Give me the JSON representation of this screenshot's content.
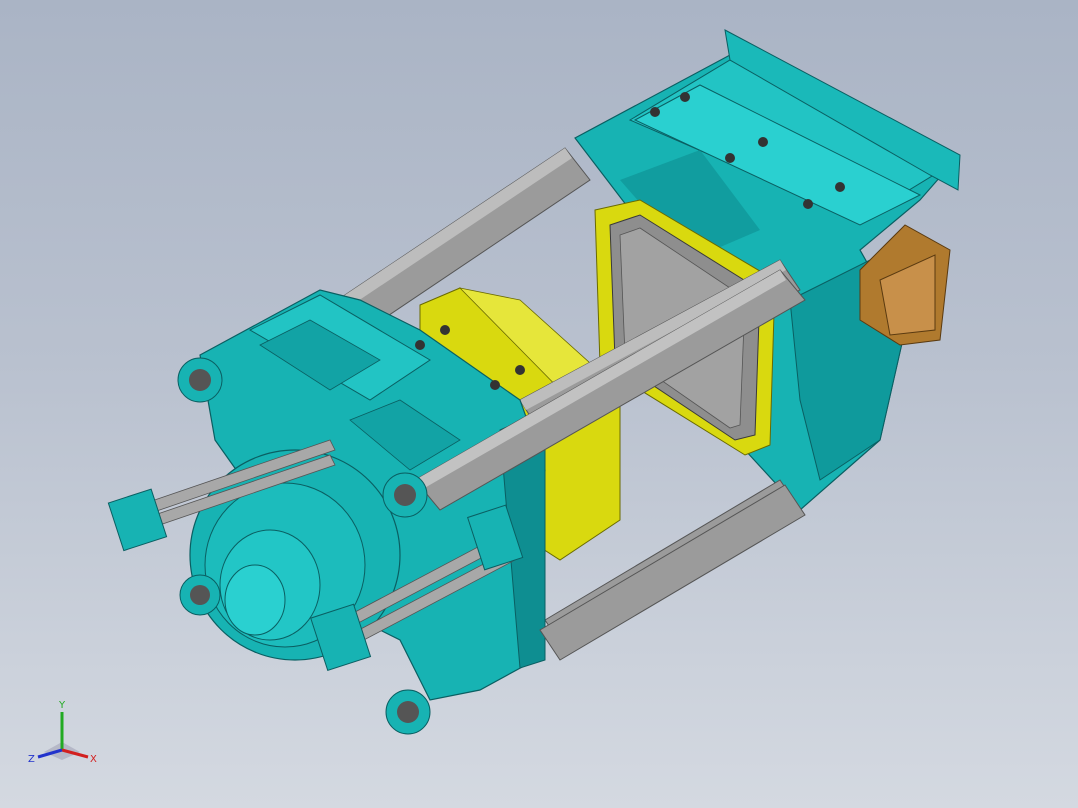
{
  "viewport": {
    "background_top": "#aab4c5",
    "background_bottom": "#d4d9e1"
  },
  "colors": {
    "platen": "#17b3b3",
    "platen_dark": "#0e8e91",
    "platen_light": "#33cfcf",
    "tie_bar": "#9a9a9a",
    "tie_bar_dark": "#6e6e6e",
    "mold_frame": "#d9d90f",
    "mold_plate": "#8a8a8a",
    "ejector_box": "#b07a2e",
    "bolt": "#333333"
  },
  "model": {
    "parts": [
      "tie-bar",
      "moving-platen",
      "fixed-platen",
      "rear-platen",
      "mold-frame",
      "clamp-cylinder",
      "ejector-box"
    ]
  },
  "triad": {
    "x_label": "X",
    "y_label": "Y",
    "z_label": "Z",
    "x_color": "#d22020",
    "y_color": "#22aa22",
    "z_color": "#2233cc"
  }
}
